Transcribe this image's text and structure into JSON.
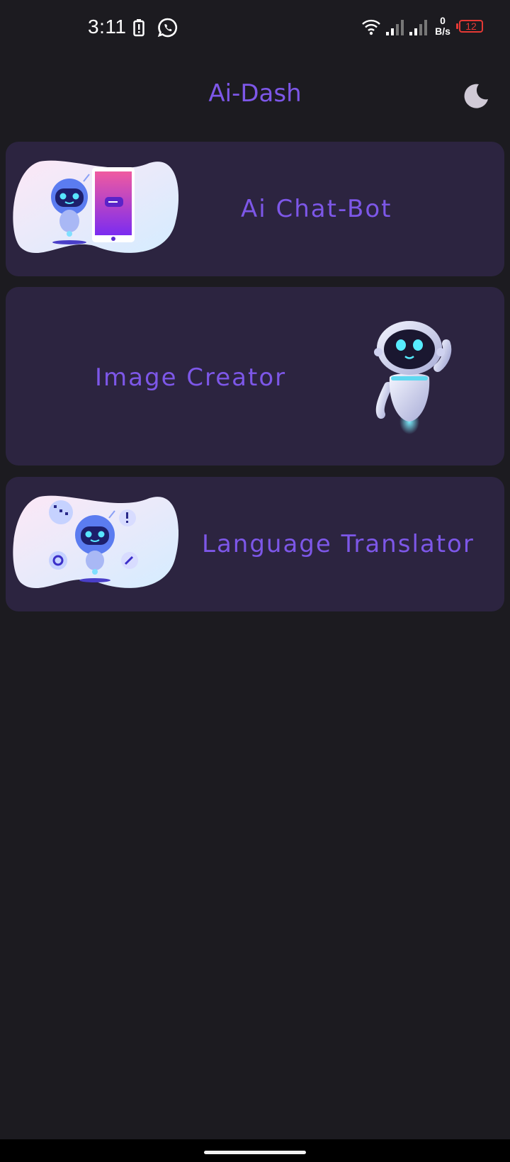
{
  "status_bar": {
    "time": "3:11",
    "net_speed_value": "0",
    "net_speed_unit": "B/s",
    "battery_level": "12",
    "icons": [
      "battery-saver-icon",
      "whatsapp-icon",
      "wifi-icon",
      "signal-icon",
      "signal-icon",
      "battery-icon"
    ]
  },
  "header": {
    "title": "Ai-Dash",
    "theme_icon": "moon-icon"
  },
  "cards": [
    {
      "label": "Ai Chat-Bot",
      "image": "robot-with-phone-illustration"
    },
    {
      "label": "Image Creator",
      "image": "waving-robot-illustration"
    },
    {
      "label": "Language Translator",
      "image": "robot-with-chat-bubbles-illustration"
    }
  ],
  "colors": {
    "background": "#1c1b20",
    "card": "#2c2440",
    "accent": "#7d57e8",
    "battery_low": "#e53935"
  }
}
